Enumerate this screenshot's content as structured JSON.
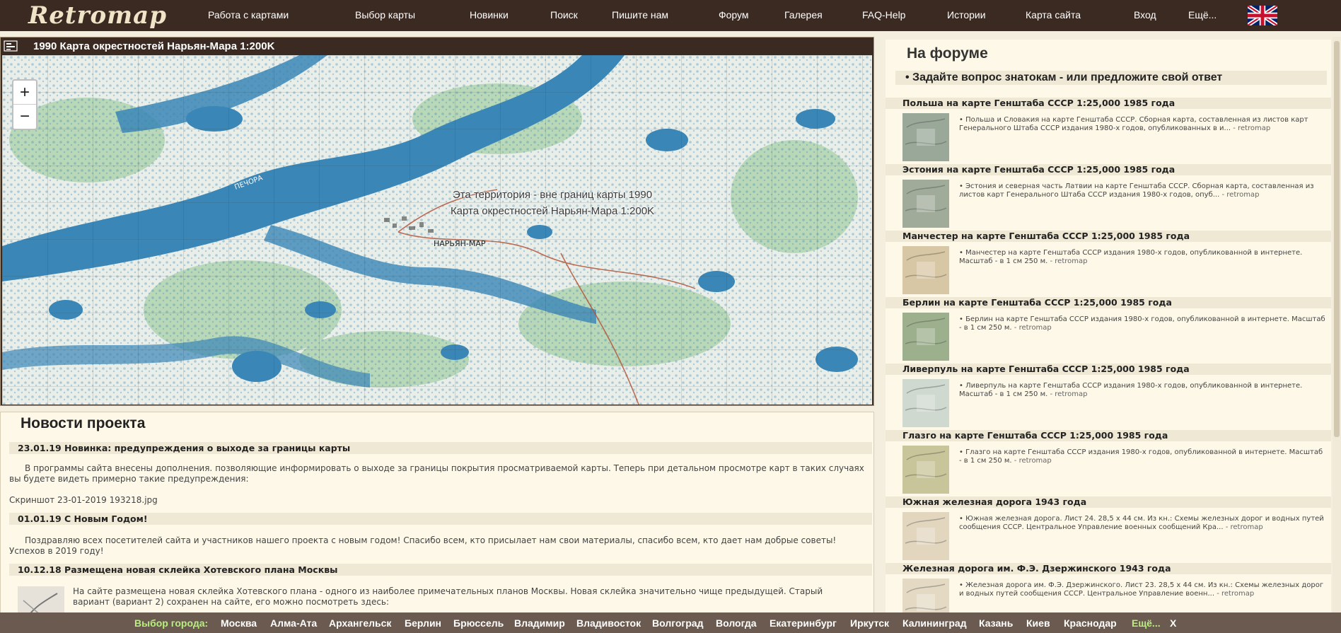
{
  "nav": {
    "logo": "Retromap",
    "items": [
      "Работа с картами",
      "Выбор карты",
      "Новинки",
      "Поиск",
      "Пишите нам",
      "Форум",
      "Галерея",
      "FAQ-Help",
      "Истории",
      "Карта сайта",
      "Вход",
      "Ещё..."
    ],
    "flag_icon": "uk-flag-icon"
  },
  "map": {
    "title": "1990 Карта окрестностей Нарьян-Мара 1:200K",
    "zoom_in": "+",
    "zoom_out": "−",
    "warning": "Эта территория - вне границ карты 1990 Карта окрестностей Нарьян-Мара 1:200K",
    "labels": [
      "НАРЬЯН-МАР",
      "ПЕЧОРА"
    ],
    "colors": {
      "water": "#3a86b6",
      "land": "#e8efe8",
      "forest": "#9fcaa2"
    }
  },
  "news": {
    "heading": "Новости проекта",
    "items": [
      {
        "title": "23.01.19 Новинка: предупреждения о выходе за границы карты",
        "body": "В программы сайта внесены дополнения. позволяющие информировать о выходе за границы покрытия просматриваемой карты. Теперь при детальном просмотре карт в таких случаях вы будете видеть примерно такие предупреждения:",
        "extra": "Скриншот 23-01-2019 193218.jpg"
      },
      {
        "title": "01.01.19 С Новым Годом!",
        "body": "Поздравляю всех посетителей сайта и участников нашего проекта с новым годом! Спасибо всем, кто присылает нам свои материалы, спасибо всем, кто дает нам добрые советы! Успехов в 2019 году!"
      },
      {
        "title": "10.12.18 Размещена новая склейка Хотевского плана Москвы",
        "body": "На сайте размещена новая склейка Хотевского плана - одного из наиболее примечательных планов Москвы. Новая склейка значительно чище предыдущей. Старый вариант (вариант 2) сохранен на сайте, его можно посмотреть здесь:",
        "extra": "0818526"
      }
    ]
  },
  "forum": {
    "heading": "На форуме",
    "ask": "• Задайте вопрос знатокам - или предложите свой ответ",
    "source": "- retromap",
    "items": [
      {
        "title": "Польша на карте Генштаба СССР 1:25,000 1985 года",
        "desc": "• Польша и Словакия на карте Генштаба СССР. Сборная карта, составленная из листов карт Генерального Штаба СССР издания 1980-х годов, опубликованных в и...",
        "thumb_color": "#9aa89a"
      },
      {
        "title": "Эстония на карте Генштаба СССР 1:25,000 1985 года",
        "desc": "• Эстония и северная часть Латвии на карте Генштаба СССР. Сборная карта, составленная из листов карт Генерального Штаба СССР издания 1980-х годов, опуб...",
        "thumb_color": "#a0ab9a"
      },
      {
        "title": "Манчестер на карте Генштаба СССР 1:25,000 1985 года",
        "desc": "• Манчестер на карте Генштаба СССР издания 1980-х годов, опубликованной в интернете. Масштаб - в 1 см 250 м.",
        "thumb_color": "#d8c7a4"
      },
      {
        "title": "Берлин на карте Генштаба СССР 1:25,000 1985 года",
        "desc": "• Берлин на карте Генштаба СССР издания 1980-х годов, опубликованной в интернете. Масштаб - в 1 см 250 м.",
        "thumb_color": "#9db08d"
      },
      {
        "title": "Ливерпуль на карте Генштаба СССР 1:25,000 1985 года",
        "desc": "• Ливерпуль на карте Генштаба СССР издания 1980-х годов, опубликованной в интернете. Масштаб - в 1 см 250 м.",
        "thumb_color": "#cfd9d0"
      },
      {
        "title": "Глазго на карте Генштаба СССР 1:25,000 1985 года",
        "desc": "• Глазго на карте Генштаба СССР издания 1980-х годов, опубликованной в интернете. Масштаб - в 1 см 250 м.",
        "thumb_color": "#c8c59a"
      },
      {
        "title": "Южная железная дорога 1943 года",
        "desc": "• Южная железная дорога. Лист 24. 28,5 х 44 см. Из кн.: Схемы железных дорог и водных путей сообщения СССР. Центральное Управление военных сообщений Кра...",
        "thumb_color": "#e2d6bf"
      },
      {
        "title": "Железная дорога им. Ф.Э. Дзержинского 1943 года",
        "desc": "• Железная дорога им. Ф.Э. Дзержинского. Лист 23. 28,5 х 44 см. Из кн.: Схемы железных дорог и водных путей сообщения СССР. Центральное Управление военн...",
        "thumb_color": "#e4dac4"
      }
    ]
  },
  "citybar": {
    "label": "Выбор города:",
    "cities": [
      "Москва",
      "Алма-Ата",
      "Архангельск",
      "Берлин",
      "Брюссель",
      "Владимир",
      "Владивосток",
      "Волгоград",
      "Вологда",
      "Екатеринбург",
      "Иркутск",
      "Калининград",
      "Казань",
      "Киев",
      "Краснодар"
    ],
    "more": "Ещё...",
    "close": "X"
  }
}
